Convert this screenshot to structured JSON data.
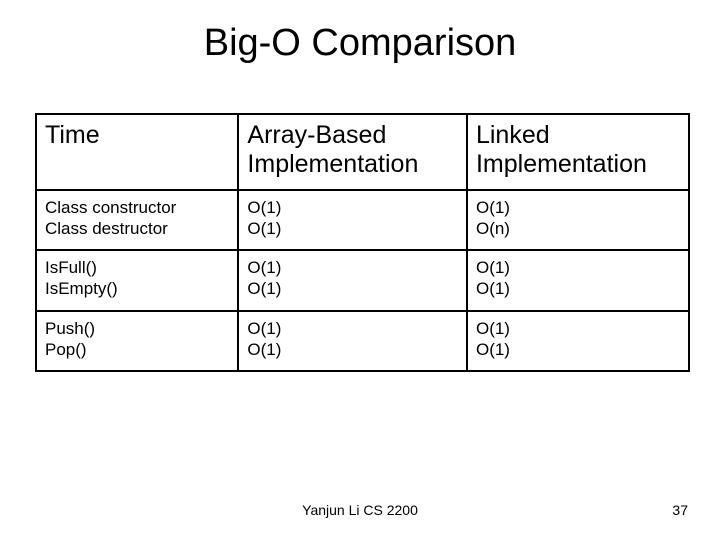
{
  "title": "Big-O Comparison",
  "headers": {
    "c1": "Time",
    "c2": "Array-Based Implementation",
    "c3": "Linked Implementation"
  },
  "rows": [
    {
      "label_a": "Class constructor",
      "label_b": "Class destructor",
      "array_a": "O(1)",
      "array_b": "O(1)",
      "linked_a": "O(1)",
      "linked_b": "O(n)"
    },
    {
      "label_a": "IsFull()",
      "label_b": "IsEmpty()",
      "array_a": "O(1)",
      "array_b": "O(1)",
      "linked_a": "O(1)",
      "linked_b": "O(1)"
    },
    {
      "label_a": "Push()",
      "label_b": "Pop()",
      "array_a": "O(1)",
      "array_b": "O(1)",
      "linked_a": "O(1)",
      "linked_b": "O(1)"
    }
  ],
  "footer": {
    "center": "Yanjun Li  CS 2200",
    "page": "37"
  }
}
